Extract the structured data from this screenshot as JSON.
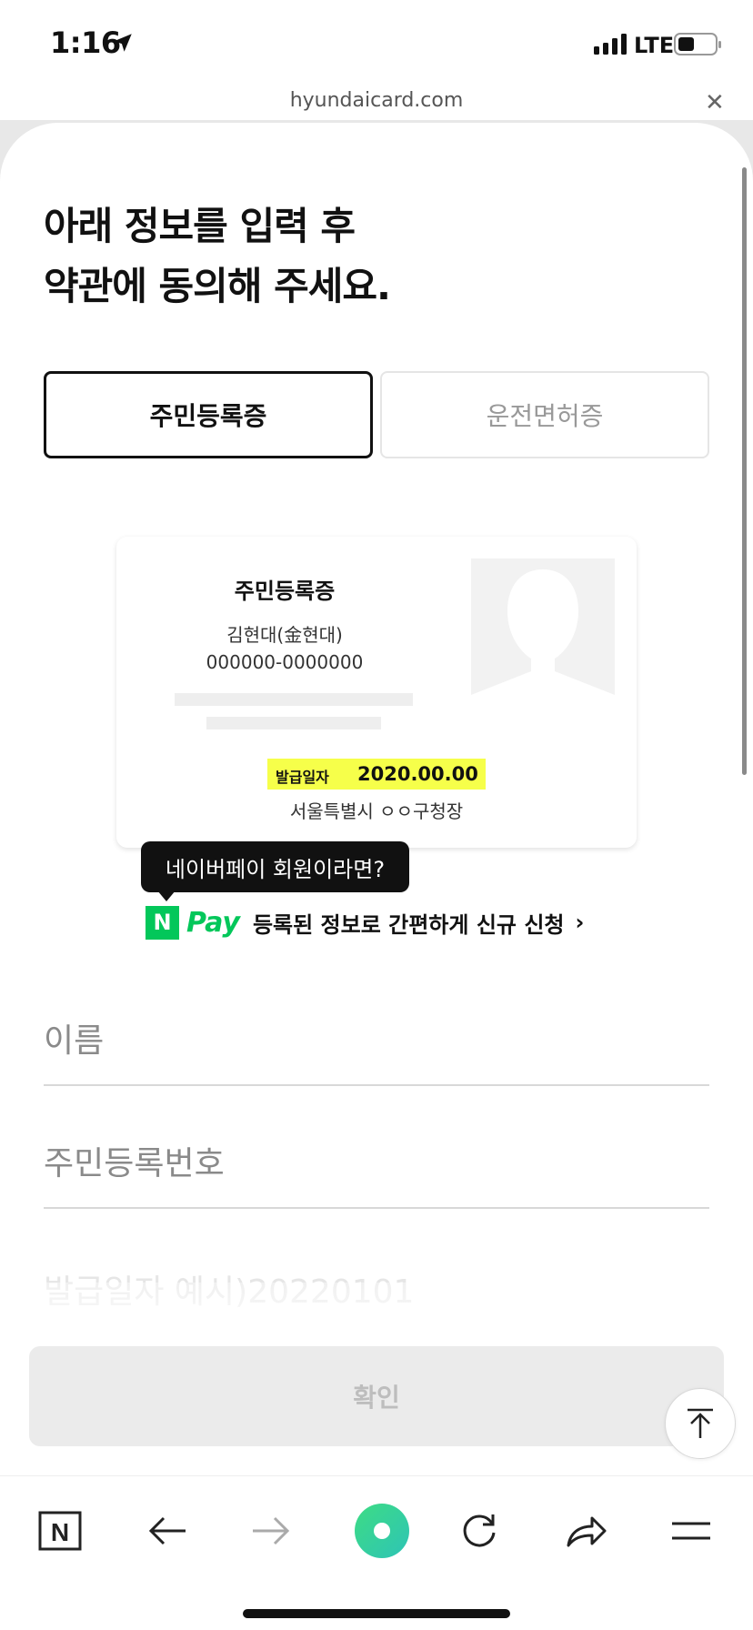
{
  "status_bar": {
    "time": "1:16",
    "network": "LTE"
  },
  "browser": {
    "url": "hyundaicard.com",
    "close_label": "✕"
  },
  "page": {
    "title_line1": "아래 정보를 입력 후",
    "title_line2": "약관에 동의해 주세요.",
    "tabs": [
      {
        "label": "주민등록증",
        "selected": true
      },
      {
        "label": "운전면허증",
        "selected": false
      }
    ]
  },
  "id_card": {
    "title": "주민등록증",
    "name": "김현대(金현대)",
    "number": "000000-0000000",
    "issue_label": "발급일자",
    "issue_date": "2020.00.00",
    "issuer": "서울특별시 ㅇㅇ구청장",
    "highlight_color": "#f6ff4a"
  },
  "naver_pay": {
    "tooltip": "네이버페이 회원이라면?",
    "logo_letter": "N",
    "logo_text": "Pay",
    "link_text": "등록된 정보로 간편하게 신규 신청",
    "chevron": "›",
    "brand_color": "#03c75a"
  },
  "form": {
    "name_placeholder": "이름",
    "rrn_placeholder": "주민등록번호",
    "date_placeholder": "발급일자 예시)20220101",
    "confirm_label": "확인"
  },
  "toolbar": {
    "icons": [
      "naver-n-icon",
      "back-arrow-icon",
      "forward-arrow-icon",
      "green-dot-icon",
      "refresh-icon",
      "share-icon",
      "menu-icon"
    ],
    "naver_letter": "N"
  }
}
